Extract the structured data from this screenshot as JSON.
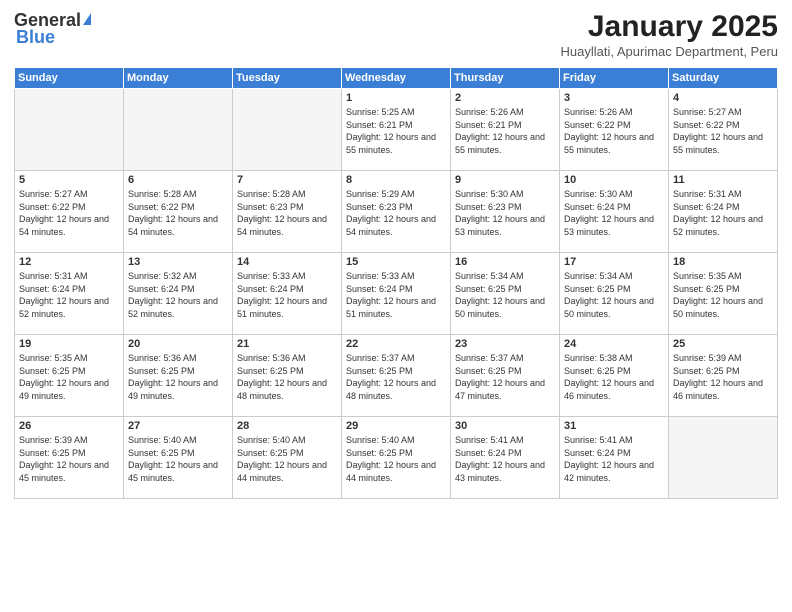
{
  "header": {
    "logo_general": "General",
    "logo_blue": "Blue",
    "month_title": "January 2025",
    "subtitle": "Huayllati, Apurimac Department, Peru"
  },
  "weekdays": [
    "Sunday",
    "Monday",
    "Tuesday",
    "Wednesday",
    "Thursday",
    "Friday",
    "Saturday"
  ],
  "weeks": [
    [
      {
        "day": "",
        "empty": true
      },
      {
        "day": "",
        "empty": true
      },
      {
        "day": "",
        "empty": true
      },
      {
        "day": "1",
        "sunrise": "5:25 AM",
        "sunset": "6:21 PM",
        "daylight": "12 hours and 55 minutes."
      },
      {
        "day": "2",
        "sunrise": "5:26 AM",
        "sunset": "6:21 PM",
        "daylight": "12 hours and 55 minutes."
      },
      {
        "day": "3",
        "sunrise": "5:26 AM",
        "sunset": "6:22 PM",
        "daylight": "12 hours and 55 minutes."
      },
      {
        "day": "4",
        "sunrise": "5:27 AM",
        "sunset": "6:22 PM",
        "daylight": "12 hours and 55 minutes."
      }
    ],
    [
      {
        "day": "5",
        "sunrise": "5:27 AM",
        "sunset": "6:22 PM",
        "daylight": "12 hours and 54 minutes."
      },
      {
        "day": "6",
        "sunrise": "5:28 AM",
        "sunset": "6:22 PM",
        "daylight": "12 hours and 54 minutes."
      },
      {
        "day": "7",
        "sunrise": "5:28 AM",
        "sunset": "6:23 PM",
        "daylight": "12 hours and 54 minutes."
      },
      {
        "day": "8",
        "sunrise": "5:29 AM",
        "sunset": "6:23 PM",
        "daylight": "12 hours and 54 minutes."
      },
      {
        "day": "9",
        "sunrise": "5:30 AM",
        "sunset": "6:23 PM",
        "daylight": "12 hours and 53 minutes."
      },
      {
        "day": "10",
        "sunrise": "5:30 AM",
        "sunset": "6:24 PM",
        "daylight": "12 hours and 53 minutes."
      },
      {
        "day": "11",
        "sunrise": "5:31 AM",
        "sunset": "6:24 PM",
        "daylight": "12 hours and 52 minutes."
      }
    ],
    [
      {
        "day": "12",
        "sunrise": "5:31 AM",
        "sunset": "6:24 PM",
        "daylight": "12 hours and 52 minutes."
      },
      {
        "day": "13",
        "sunrise": "5:32 AM",
        "sunset": "6:24 PM",
        "daylight": "12 hours and 52 minutes."
      },
      {
        "day": "14",
        "sunrise": "5:33 AM",
        "sunset": "6:24 PM",
        "daylight": "12 hours and 51 minutes."
      },
      {
        "day": "15",
        "sunrise": "5:33 AM",
        "sunset": "6:24 PM",
        "daylight": "12 hours and 51 minutes."
      },
      {
        "day": "16",
        "sunrise": "5:34 AM",
        "sunset": "6:25 PM",
        "daylight": "12 hours and 50 minutes."
      },
      {
        "day": "17",
        "sunrise": "5:34 AM",
        "sunset": "6:25 PM",
        "daylight": "12 hours and 50 minutes."
      },
      {
        "day": "18",
        "sunrise": "5:35 AM",
        "sunset": "6:25 PM",
        "daylight": "12 hours and 50 minutes."
      }
    ],
    [
      {
        "day": "19",
        "sunrise": "5:35 AM",
        "sunset": "6:25 PM",
        "daylight": "12 hours and 49 minutes."
      },
      {
        "day": "20",
        "sunrise": "5:36 AM",
        "sunset": "6:25 PM",
        "daylight": "12 hours and 49 minutes."
      },
      {
        "day": "21",
        "sunrise": "5:36 AM",
        "sunset": "6:25 PM",
        "daylight": "12 hours and 48 minutes."
      },
      {
        "day": "22",
        "sunrise": "5:37 AM",
        "sunset": "6:25 PM",
        "daylight": "12 hours and 48 minutes."
      },
      {
        "day": "23",
        "sunrise": "5:37 AM",
        "sunset": "6:25 PM",
        "daylight": "12 hours and 47 minutes."
      },
      {
        "day": "24",
        "sunrise": "5:38 AM",
        "sunset": "6:25 PM",
        "daylight": "12 hours and 46 minutes."
      },
      {
        "day": "25",
        "sunrise": "5:39 AM",
        "sunset": "6:25 PM",
        "daylight": "12 hours and 46 minutes."
      }
    ],
    [
      {
        "day": "26",
        "sunrise": "5:39 AM",
        "sunset": "6:25 PM",
        "daylight": "12 hours and 45 minutes."
      },
      {
        "day": "27",
        "sunrise": "5:40 AM",
        "sunset": "6:25 PM",
        "daylight": "12 hours and 45 minutes."
      },
      {
        "day": "28",
        "sunrise": "5:40 AM",
        "sunset": "6:25 PM",
        "daylight": "12 hours and 44 minutes."
      },
      {
        "day": "29",
        "sunrise": "5:40 AM",
        "sunset": "6:25 PM",
        "daylight": "12 hours and 44 minutes."
      },
      {
        "day": "30",
        "sunrise": "5:41 AM",
        "sunset": "6:24 PM",
        "daylight": "12 hours and 43 minutes."
      },
      {
        "day": "31",
        "sunrise": "5:41 AM",
        "sunset": "6:24 PM",
        "daylight": "12 hours and 42 minutes."
      },
      {
        "day": "",
        "empty": true
      }
    ]
  ]
}
